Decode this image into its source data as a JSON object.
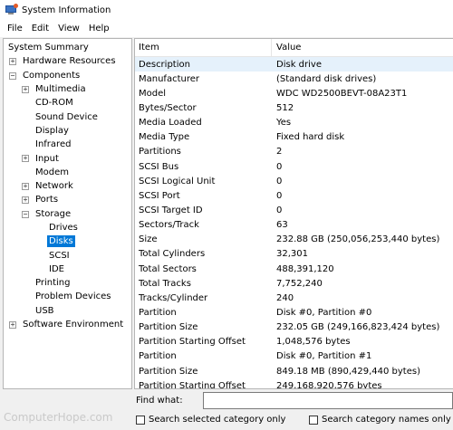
{
  "window": {
    "title": "System Information"
  },
  "menu": {
    "items": [
      "File",
      "Edit",
      "View",
      "Help"
    ]
  },
  "tree": {
    "items": [
      {
        "label": "System Summary",
        "level": 0,
        "expander": ""
      },
      {
        "label": "Hardware Resources",
        "level": 1,
        "expander": "+"
      },
      {
        "label": "Components",
        "level": 1,
        "expander": "−"
      },
      {
        "label": "Multimedia",
        "level": 2,
        "expander": "+"
      },
      {
        "label": "CD-ROM",
        "level": 2,
        "expander": ""
      },
      {
        "label": "Sound Device",
        "level": 2,
        "expander": ""
      },
      {
        "label": "Display",
        "level": 2,
        "expander": ""
      },
      {
        "label": "Infrared",
        "level": 2,
        "expander": ""
      },
      {
        "label": "Input",
        "level": 2,
        "expander": "+"
      },
      {
        "label": "Modem",
        "level": 2,
        "expander": ""
      },
      {
        "label": "Network",
        "level": 2,
        "expander": "+"
      },
      {
        "label": "Ports",
        "level": 2,
        "expander": "+"
      },
      {
        "label": "Storage",
        "level": 2,
        "expander": "−"
      },
      {
        "label": "Drives",
        "level": 3,
        "expander": ""
      },
      {
        "label": "Disks",
        "level": 3,
        "expander": "",
        "selected": true
      },
      {
        "label": "SCSI",
        "level": 3,
        "expander": ""
      },
      {
        "label": "IDE",
        "level": 3,
        "expander": ""
      },
      {
        "label": "Printing",
        "level": 2,
        "expander": ""
      },
      {
        "label": "Problem Devices",
        "level": 2,
        "expander": ""
      },
      {
        "label": "USB",
        "level": 2,
        "expander": ""
      },
      {
        "label": "Software Environment",
        "level": 1,
        "expander": "+"
      }
    ]
  },
  "grid": {
    "columns": [
      "Item",
      "Value"
    ],
    "rows": [
      [
        "Description",
        "Disk drive"
      ],
      [
        "Manufacturer",
        "(Standard disk drives)"
      ],
      [
        "Model",
        "WDC WD2500BEVT-08A23T1"
      ],
      [
        "Bytes/Sector",
        "512"
      ],
      [
        "Media Loaded",
        "Yes"
      ],
      [
        "Media Type",
        "Fixed hard disk"
      ],
      [
        "Partitions",
        "2"
      ],
      [
        "SCSI Bus",
        "0"
      ],
      [
        "SCSI Logical Unit",
        "0"
      ],
      [
        "SCSI Port",
        "0"
      ],
      [
        "SCSI Target ID",
        "0"
      ],
      [
        "Sectors/Track",
        "63"
      ],
      [
        "Size",
        "232.88 GB (250,056,253,440 bytes)"
      ],
      [
        "Total Cylinders",
        "32,301"
      ],
      [
        "Total Sectors",
        "488,391,120"
      ],
      [
        "Total Tracks",
        "7,752,240"
      ],
      [
        "Tracks/Cylinder",
        "240"
      ],
      [
        "Partition",
        "Disk #0, Partition #0"
      ],
      [
        "Partition Size",
        "232.05 GB (249,166,823,424 bytes)"
      ],
      [
        "Partition Starting Offset",
        "1,048,576 bytes"
      ],
      [
        "Partition",
        "Disk #0, Partition #1"
      ],
      [
        "Partition Size",
        "849.18 MB (890,429,440 bytes)"
      ],
      [
        "Partition Starting Offset",
        "249,168,920,576 bytes"
      ]
    ]
  },
  "find": {
    "label": "Find what:",
    "value": "",
    "check_selected_label": "Search selected category only",
    "check_names_label": "Search category names only"
  },
  "watermark": "ComputerHope.com"
}
